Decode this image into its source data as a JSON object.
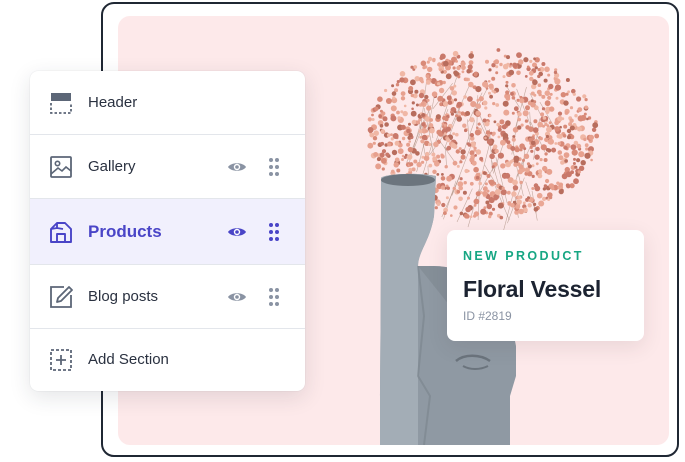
{
  "sections": [
    {
      "label": "Header",
      "icon": "header-layout-icon",
      "actions": false
    },
    {
      "label": "Gallery",
      "icon": "image-icon",
      "actions": true
    },
    {
      "label": "Products",
      "icon": "shop-icon",
      "actions": true,
      "active": true
    },
    {
      "label": "Blog posts",
      "icon": "edit-icon",
      "actions": true
    },
    {
      "label": "Add Section",
      "icon": "add-section-icon",
      "actions": false
    }
  ],
  "product_card": {
    "badge": "NEW PRODUCT",
    "name": "Floral Vessel",
    "id": "ID #2819"
  },
  "colors": {
    "accent": "#4a45c7",
    "active_row": "#f1f0fd",
    "badge": "#17a683",
    "canvas_bg": "#fde9ea",
    "frame_border": "#1f2733"
  }
}
